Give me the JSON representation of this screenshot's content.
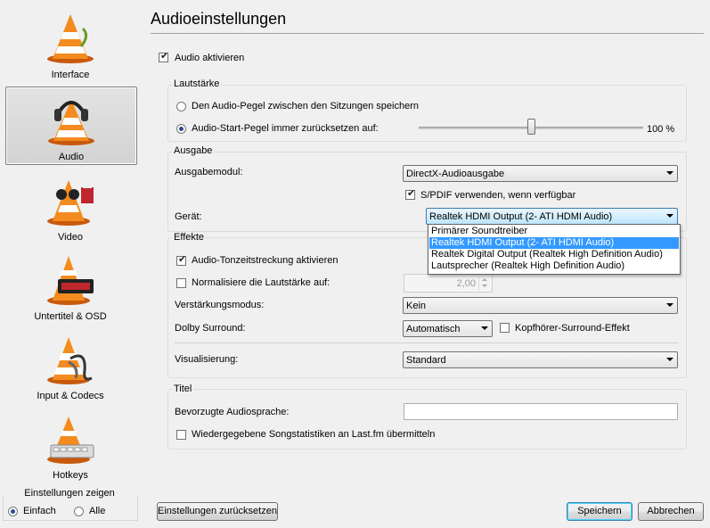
{
  "sidebar": {
    "items": [
      {
        "label": "Interface",
        "icon": "vlc-cone-icon",
        "selected": false
      },
      {
        "label": "Audio",
        "icon": "vlc-headphones-cone-icon",
        "selected": true
      },
      {
        "label": "Video",
        "icon": "vlc-glasses-cone-icon",
        "selected": false
      },
      {
        "label": "Untertitel & OSD",
        "icon": "vlc-subtitle-cone-icon",
        "selected": false
      },
      {
        "label": "Input & Codecs",
        "icon": "vlc-cable-cone-icon",
        "selected": false
      },
      {
        "label": "Hotkeys",
        "icon": "vlc-keyboard-cone-icon",
        "selected": false
      }
    ],
    "show_settings": {
      "title": "Einstellungen zeigen",
      "simple_label": "Einfach",
      "all_label": "Alle",
      "selected": "Einfach"
    }
  },
  "main": {
    "title": "Audioeinstellungen",
    "enable_audio": {
      "label": "Audio aktivieren",
      "checked": true
    },
    "volume": {
      "title": "Lautstärke",
      "save_level_label": "Den Audio-Pegel zwischen den Sitzungen speichern",
      "reset_level_label": "Audio-Start-Pegel immer zurücksetzen auf:",
      "selected": "reset",
      "level_percent": 100,
      "level_text": "100 %"
    },
    "output": {
      "title": "Ausgabe",
      "module_label": "Ausgabemodul:",
      "module_value": "DirectX-Audioausgabe",
      "spdif_label": "S/PDIF verwenden, wenn verfügbar",
      "spdif_checked": true,
      "device_label": "Gerät:",
      "device_value": "Realtek HDMI Output (2- ATI HDMI Audio)",
      "device_options": [
        "Primärer Soundtreiber",
        "Realtek HDMI Output (2- ATI HDMI Audio)",
        "Realtek Digital Output (Realtek High Definition Audio)",
        "Lautsprecher (Realtek High Definition Audio)"
      ]
    },
    "effects": {
      "title": "Effekte",
      "time_stretch_label": "Audio-Tonzeitstreckung aktivieren",
      "time_stretch_checked": true,
      "normalize_label": "Normalisiere die Lautstärke auf:",
      "normalize_checked": false,
      "normalize_value": "2,00",
      "replaygain_label": "Verstärkungsmodus:",
      "replaygain_value": "Kein",
      "dolby_label": "Dolby Surround:",
      "dolby_value": "Automatisch",
      "headphone_label": "Kopfhörer-Surround-Effekt",
      "headphone_checked": false,
      "visualization_label": "Visualisierung:",
      "visualization_value": "Standard"
    },
    "tracks": {
      "title": "Titel",
      "language_label": "Bevorzugte Audiosprache:",
      "language_value": "",
      "lastfm_label": "Wiedergegebene Songstatistiken an Last.fm übermitteln",
      "lastfm_checked": false
    }
  },
  "footer": {
    "reset_label": "Einstellungen zurücksetzen",
    "save_label": "Speichern",
    "cancel_label": "Abbrechen"
  }
}
